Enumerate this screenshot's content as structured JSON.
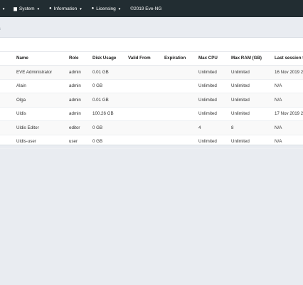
{
  "navbar": {
    "items": [
      {
        "label": "t",
        "icon": "",
        "caret": true
      },
      {
        "label": "System",
        "icon": "file-icon",
        "caret": true
      },
      {
        "label": "Information",
        "icon": "info-icon",
        "caret": true
      },
      {
        "label": "Licensing",
        "icon": "license-icon",
        "caret": true
      }
    ],
    "copyright": "©2019 Eve-NG",
    "background": "#222d32"
  },
  "breadcrumb": "s",
  "table": {
    "headers": [
      "Name",
      "Role",
      "Disk Usage",
      "Valid From",
      "Expiration",
      "Max CPU",
      "Max RAM (GB)",
      "Last session t"
    ],
    "rows": [
      [
        "EVE Administrator",
        "admin",
        "0.01 GB",
        "",
        "",
        "Unlimited",
        "Unlimited",
        "16 Nov 2019 2"
      ],
      [
        "Alain",
        "admin",
        "0 GB",
        "",
        "",
        "Unlimited",
        "Unlimited",
        "N/A"
      ],
      [
        "Olga",
        "admin",
        "0.01 GB",
        "",
        "",
        "Unlimited",
        "Unlimited",
        "N/A"
      ],
      [
        "Uldis",
        "admin",
        "100.26 GB",
        "",
        "",
        "Unlimited",
        "Unlimited",
        "17 Nov 2019 2"
      ],
      [
        "Uldis Editor",
        "editor",
        "0 GB",
        "",
        "",
        "4",
        "8",
        "N/A"
      ],
      [
        "Uldis-user",
        "user",
        "0 GB",
        "",
        "",
        "Unlimited",
        "Unlimited",
        "N/A"
      ]
    ]
  }
}
